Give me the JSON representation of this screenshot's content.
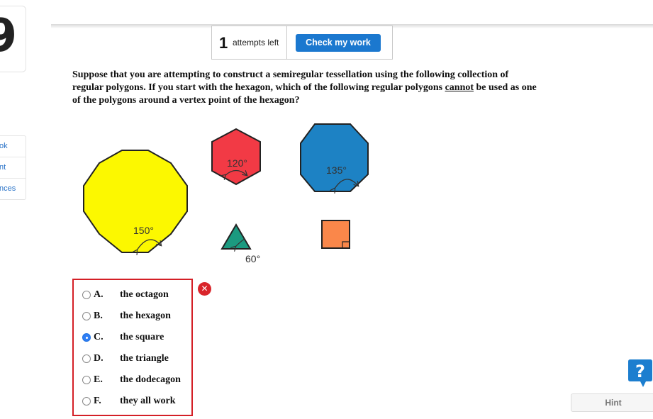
{
  "sidebar": {
    "card_digit": "9",
    "nav_items": [
      {
        "label": "ok"
      },
      {
        "label": "nt"
      },
      {
        "label": "nces"
      }
    ]
  },
  "header": {
    "attempts_count": "1",
    "attempts_label": "attempts left",
    "check_button_label": "Check my work"
  },
  "question": {
    "text_before": "Suppose that you are attempting to construct a semiregular tessellation using the following collection of regular polygons. If you start with the hexagon, which of the following regular polygons ",
    "emphasis": "cannot",
    "text_after": " be used as one of the polygons around a vertex point of the hexagon?"
  },
  "figure": {
    "dodecagon_angle": "150°",
    "hexagon_angle": "120°",
    "octagon_angle": "135°",
    "triangle_angle": "60°",
    "colors": {
      "dodecagon": "#fcf800",
      "hexagon": "#f23a45",
      "octagon": "#1d82c4",
      "triangle": "#1b9a80",
      "square": "#fa874a"
    }
  },
  "answers": {
    "selected": "C",
    "options": [
      {
        "letter": "A.",
        "text": "the octagon"
      },
      {
        "letter": "B.",
        "text": "the hexagon"
      },
      {
        "letter": "C.",
        "text": "the square"
      },
      {
        "letter": "D.",
        "text": "the triangle"
      },
      {
        "letter": "E.",
        "text": "the dodecagon"
      },
      {
        "letter": "F.",
        "text": "they all work"
      }
    ]
  },
  "feedback": {
    "wrong_icon": "x-circle-icon"
  },
  "footer": {
    "help_icon": "question-bubble-icon",
    "hint_label": "Hint"
  }
}
